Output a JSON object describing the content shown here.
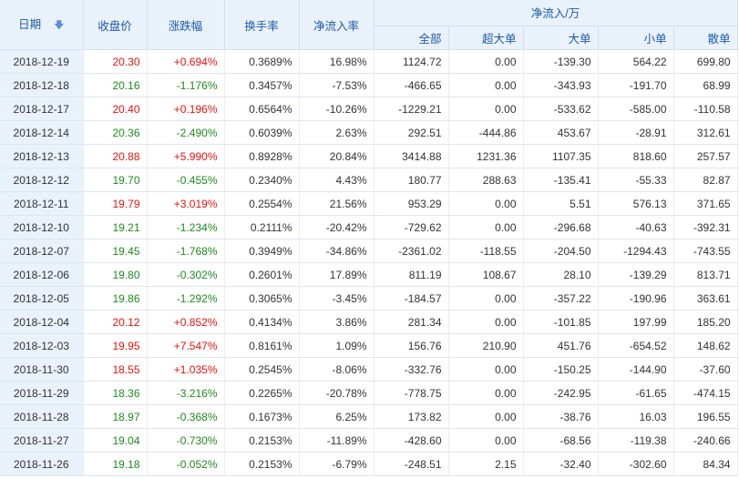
{
  "headers": {
    "date": "日期",
    "close": "收盘价",
    "change": "涨跌幅",
    "turnover": "换手率",
    "net_inflow_rate": "净流入率",
    "net_inflow_group": "净流入/万",
    "all": "全部",
    "xlarge": "超大单",
    "large": "大单",
    "small": "小单",
    "retail": "散单"
  },
  "colors": {
    "up": "#e6140e",
    "down": "#1f8a1f",
    "header_text": "#1e5cab",
    "header_bg": "#e9f1fa"
  },
  "sort_icon": "arrow-down-icon",
  "rows": [
    {
      "date": "2018-12-19",
      "close": "20.30",
      "change": "+0.694%",
      "turnover": "0.3689%",
      "net_inflow_rate": "16.98%",
      "all": "1124.72",
      "xlarge": "0.00",
      "large": "-139.30",
      "small": "564.22",
      "retail": "699.80",
      "trend": "up"
    },
    {
      "date": "2018-12-18",
      "close": "20.16",
      "change": "-1.176%",
      "turnover": "0.3457%",
      "net_inflow_rate": "-7.53%",
      "all": "-466.65",
      "xlarge": "0.00",
      "large": "-343.93",
      "small": "-191.70",
      "retail": "68.99",
      "trend": "down"
    },
    {
      "date": "2018-12-17",
      "close": "20.40",
      "change": "+0.196%",
      "turnover": "0.6564%",
      "net_inflow_rate": "-10.26%",
      "all": "-1229.21",
      "xlarge": "0.00",
      "large": "-533.62",
      "small": "-585.00",
      "retail": "-110.58",
      "trend": "up"
    },
    {
      "date": "2018-12-14",
      "close": "20.36",
      "change": "-2.490%",
      "turnover": "0.6039%",
      "net_inflow_rate": "2.63%",
      "all": "292.51",
      "xlarge": "-444.86",
      "large": "453.67",
      "small": "-28.91",
      "retail": "312.61",
      "trend": "down"
    },
    {
      "date": "2018-12-13",
      "close": "20.88",
      "change": "+5.990%",
      "turnover": "0.8928%",
      "net_inflow_rate": "20.84%",
      "all": "3414.88",
      "xlarge": "1231.36",
      "large": "1107.35",
      "small": "818.60",
      "retail": "257.57",
      "trend": "up"
    },
    {
      "date": "2018-12-12",
      "close": "19.70",
      "change": "-0.455%",
      "turnover": "0.2340%",
      "net_inflow_rate": "4.43%",
      "all": "180.77",
      "xlarge": "288.63",
      "large": "-135.41",
      "small": "-55.33",
      "retail": "82.87",
      "trend": "down"
    },
    {
      "date": "2018-12-11",
      "close": "19.79",
      "change": "+3.019%",
      "turnover": "0.2554%",
      "net_inflow_rate": "21.56%",
      "all": "953.29",
      "xlarge": "0.00",
      "large": "5.51",
      "small": "576.13",
      "retail": "371.65",
      "trend": "up"
    },
    {
      "date": "2018-12-10",
      "close": "19.21",
      "change": "-1.234%",
      "turnover": "0.2111%",
      "net_inflow_rate": "-20.42%",
      "all": "-729.62",
      "xlarge": "0.00",
      "large": "-296.68",
      "small": "-40.63",
      "retail": "-392.31",
      "trend": "down"
    },
    {
      "date": "2018-12-07",
      "close": "19.45",
      "change": "-1.768%",
      "turnover": "0.3949%",
      "net_inflow_rate": "-34.86%",
      "all": "-2361.02",
      "xlarge": "-118.55",
      "large": "-204.50",
      "small": "-1294.43",
      "retail": "-743.55",
      "trend": "down"
    },
    {
      "date": "2018-12-06",
      "close": "19.80",
      "change": "-0.302%",
      "turnover": "0.2601%",
      "net_inflow_rate": "17.89%",
      "all": "811.19",
      "xlarge": "108.67",
      "large": "28.10",
      "small": "-139.29",
      "retail": "813.71",
      "trend": "down"
    },
    {
      "date": "2018-12-05",
      "close": "19.86",
      "change": "-1.292%",
      "turnover": "0.3065%",
      "net_inflow_rate": "-3.45%",
      "all": "-184.57",
      "xlarge": "0.00",
      "large": "-357.22",
      "small": "-190.96",
      "retail": "363.61",
      "trend": "down"
    },
    {
      "date": "2018-12-04",
      "close": "20.12",
      "change": "+0.852%",
      "turnover": "0.4134%",
      "net_inflow_rate": "3.86%",
      "all": "281.34",
      "xlarge": "0.00",
      "large": "-101.85",
      "small": "197.99",
      "retail": "185.20",
      "trend": "up"
    },
    {
      "date": "2018-12-03",
      "close": "19.95",
      "change": "+7.547%",
      "turnover": "0.8161%",
      "net_inflow_rate": "1.09%",
      "all": "156.76",
      "xlarge": "210.90",
      "large": "451.76",
      "small": "-654.52",
      "retail": "148.62",
      "trend": "up"
    },
    {
      "date": "2018-11-30",
      "close": "18.55",
      "change": "+1.035%",
      "turnover": "0.2545%",
      "net_inflow_rate": "-8.06%",
      "all": "-332.76",
      "xlarge": "0.00",
      "large": "-150.25",
      "small": "-144.90",
      "retail": "-37.60",
      "trend": "up"
    },
    {
      "date": "2018-11-29",
      "close": "18.36",
      "change": "-3.216%",
      "turnover": "0.2265%",
      "net_inflow_rate": "-20.78%",
      "all": "-778.75",
      "xlarge": "0.00",
      "large": "-242.95",
      "small": "-61.65",
      "retail": "-474.15",
      "trend": "down"
    },
    {
      "date": "2018-11-28",
      "close": "18.97",
      "change": "-0.368%",
      "turnover": "0.1673%",
      "net_inflow_rate": "6.25%",
      "all": "173.82",
      "xlarge": "0.00",
      "large": "-38.76",
      "small": "16.03",
      "retail": "196.55",
      "trend": "down"
    },
    {
      "date": "2018-11-27",
      "close": "19.04",
      "change": "-0.730%",
      "turnover": "0.2153%",
      "net_inflow_rate": "-11.89%",
      "all": "-428.60",
      "xlarge": "0.00",
      "large": "-68.56",
      "small": "-119.38",
      "retail": "-240.66",
      "trend": "down"
    },
    {
      "date": "2018-11-26",
      "close": "19.18",
      "change": "-0.052%",
      "turnover": "0.2153%",
      "net_inflow_rate": "-6.79%",
      "all": "-248.51",
      "xlarge": "2.15",
      "large": "-32.40",
      "small": "-302.60",
      "retail": "84.34",
      "trend": "down"
    }
  ]
}
